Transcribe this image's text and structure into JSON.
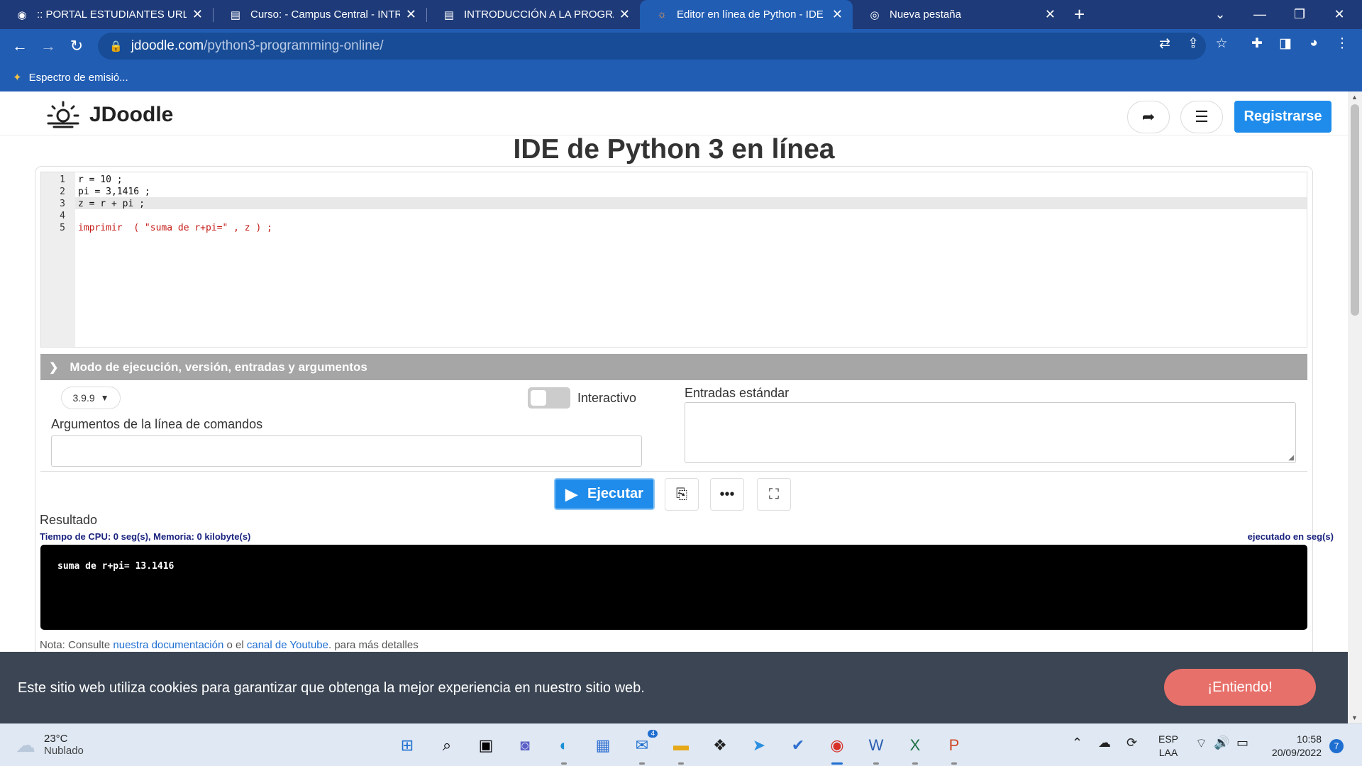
{
  "browser": {
    "tabs": [
      {
        "label": ":: PORTAL ESTUDIANTES URL ::",
        "icon": "globe-icon"
      },
      {
        "label": "Curso: - Campus Central - INTRO",
        "icon": "moodle-icon"
      },
      {
        "label": "INTRODUCCIÓN A LA PROGRAM",
        "icon": "moodle-icon"
      },
      {
        "label": "Editor en línea de Python - IDE en",
        "icon": "jdoodle-icon"
      },
      {
        "label": "Nueva pestaña",
        "icon": "chrome-icon"
      }
    ],
    "url_host": "jdoodle.com",
    "url_path": "/python3-programming-online/",
    "bookmark": "Espectro de emisió..."
  },
  "site": {
    "brand": "JDoodle",
    "register": "Registrarse",
    "title": "IDE de Python 3 en línea"
  },
  "editor": {
    "line_numbers": [
      "1",
      "2",
      "3",
      "4",
      "5"
    ],
    "lines": [
      "r = 10 ;",
      "pi = 3,1416 ;",
      "z = r + pi ;",
      "",
      "imprimir  ( \"suma de r+pi=\" , z ) ;"
    ]
  },
  "settings": {
    "section_title": "Modo de ejecución, versión, entradas y argumentos",
    "version": "3.9.9",
    "interactive": "Interactivo",
    "args_label": "Argumentos de la línea de comandos",
    "stdin_label": "Entradas estándar"
  },
  "actions": {
    "run": "Ejecutar"
  },
  "result": {
    "label": "Resultado",
    "cpu": "Tiempo de CPU: 0 seg(s), Memoria: 0 kilobyte(s)",
    "executed": "ejecutado en seg(s)",
    "output": "suma de r+pi= 13.1416"
  },
  "note": {
    "prefix": "Nota: Consulte ",
    "doc_link": "nuestra documentación",
    "middle": " o el ",
    "yt_link": "canal de Youtube",
    "suffix": ". para más detalles"
  },
  "cookie": {
    "text": "Este sitio web utiliza cookies para garantizar que obtenga la mejor experiencia en nuestro sitio web.",
    "button": "¡Entiendo!"
  },
  "taskbar": {
    "temp": "23°C",
    "weather": "Nublado",
    "lang1": "ESP",
    "lang2": "LAA",
    "time": "10:58",
    "date": "20/09/2022",
    "notifications": "7",
    "mail_badge": "4"
  },
  "colors": {
    "chrome": "#215db3",
    "accent": "#1f8ceb",
    "cookie_button": "#e8706a"
  }
}
